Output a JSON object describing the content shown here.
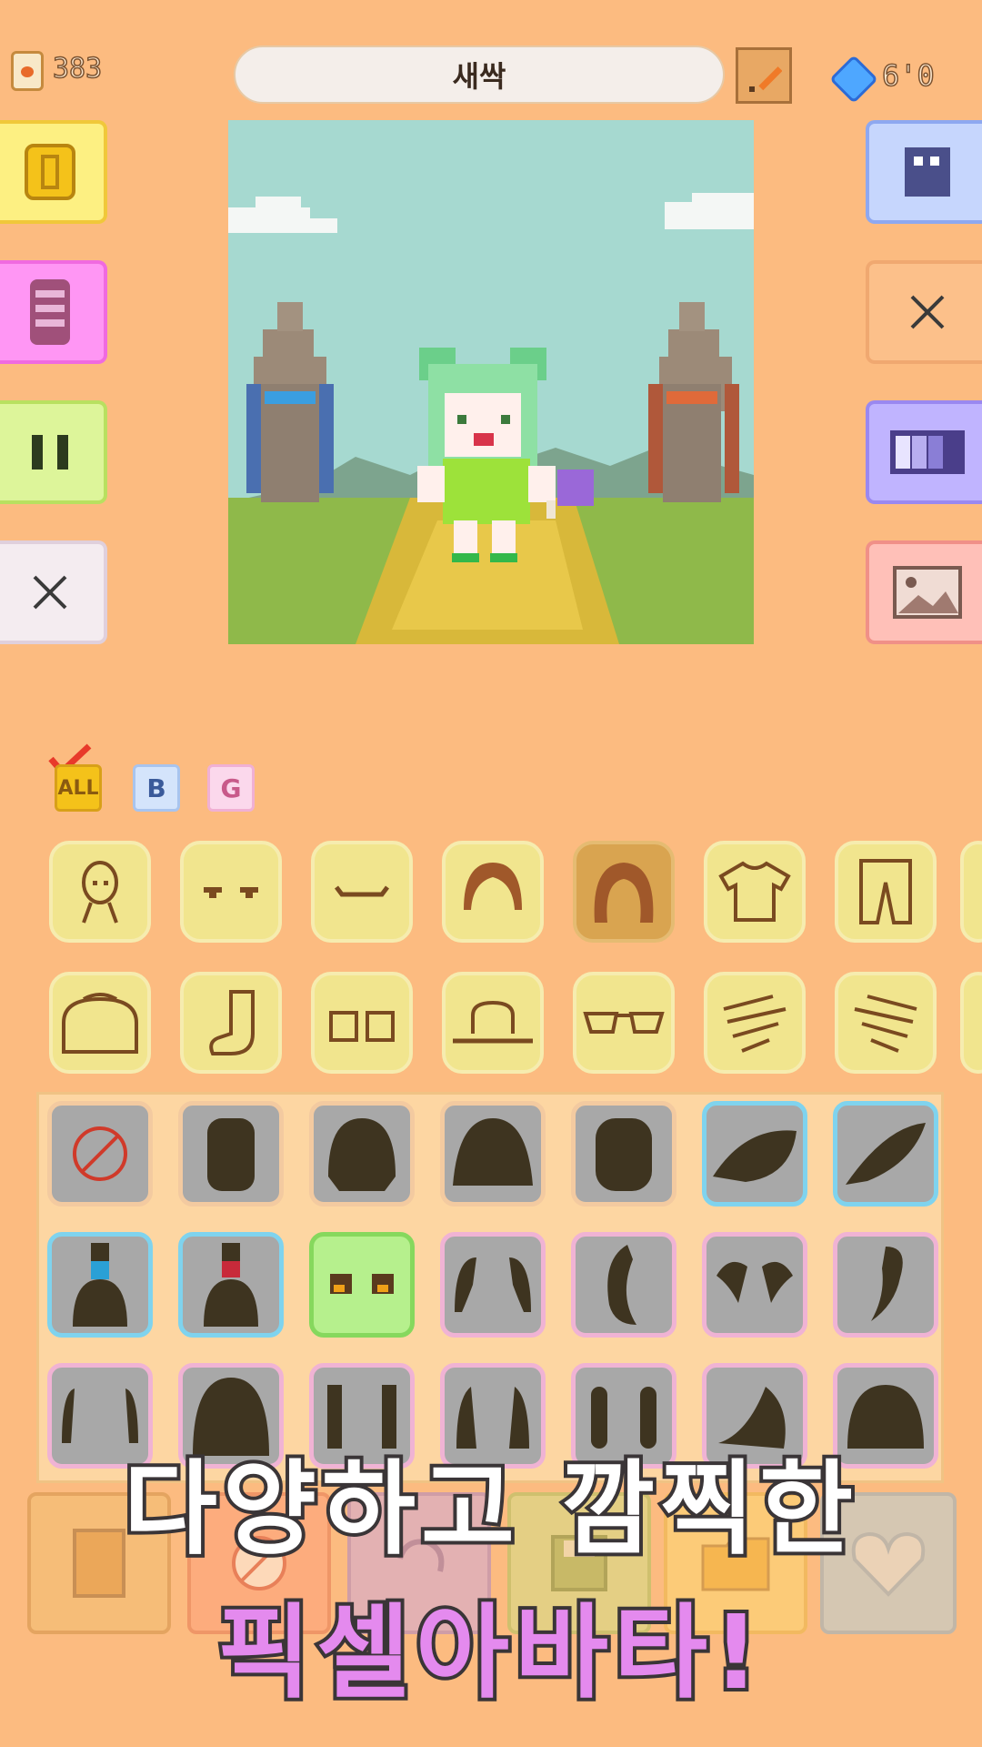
{
  "header": {
    "coins": "383",
    "avatar_name": "새싹",
    "gems": "6'0"
  },
  "filters": [
    {
      "label": "ALL",
      "selected": true
    },
    {
      "label": "B",
      "selected": false
    },
    {
      "label": "G",
      "selected": false
    }
  ],
  "categories": [
    "face-icon",
    "eyes-icon",
    "mouth-icon",
    "hair-front-icon",
    "hair-back-icon",
    "shirt-icon",
    "pants-icon",
    "bag-icon",
    "sock-icon",
    "shoes-icon",
    "hat-icon",
    "glasses-icon",
    "left-hand-icon",
    "right-hand-icon"
  ],
  "selected_category": "hair-back-icon",
  "promo": {
    "line1": "다양하고 깜찍한",
    "line2": "픽셀아바타!"
  },
  "colors": {
    "background": "#fcbb80",
    "accent_pink": "#e48aee",
    "gem": "#4ea7ff"
  }
}
